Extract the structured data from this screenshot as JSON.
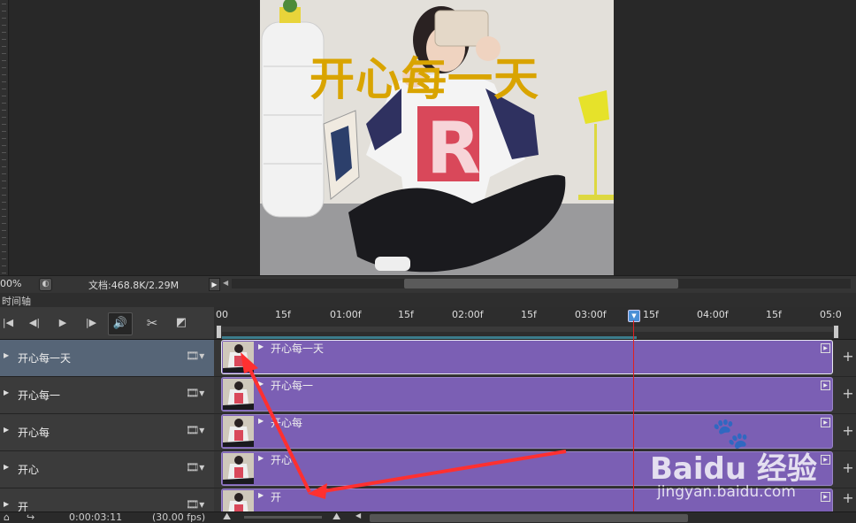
{
  "canvas": {
    "overlay_text": "开心每一天"
  },
  "statusbar": {
    "zoom": "00%",
    "doc_info": "文档:468.8K/2.29M"
  },
  "panel": {
    "tab_label": "时间轴"
  },
  "controls": {
    "first_frame": "|◀",
    "prev_frame": "◀|",
    "play": "▶",
    "next_frame": "|▶",
    "audio": "🔊",
    "split": "✂",
    "transition": "◩"
  },
  "time_ruler": {
    "labels": [
      "00",
      "15f",
      "01:00f",
      "15f",
      "02:00f",
      "15f",
      "03:00f",
      "15f",
      "04:00f",
      "15f",
      "05:0"
    ],
    "playhead_time": "0:00:03:11"
  },
  "layers": [
    {
      "name": "开心每一天",
      "clip_label": "开心每一天",
      "selected": true
    },
    {
      "name": "开心每一",
      "clip_label": "开心每一",
      "selected": false
    },
    {
      "name": "开心每",
      "clip_label": "开心每",
      "selected": false
    },
    {
      "name": "开心",
      "clip_label": "开心",
      "selected": false
    },
    {
      "name": "开",
      "clip_label": "开",
      "selected": false
    }
  ],
  "bottombar": {
    "timecode": "0:00:03:11",
    "fps": "(30.00 fps)"
  },
  "watermark": {
    "brand": "Baidu 经验",
    "url": "jingyan.baidu.com"
  },
  "colors": {
    "clip": "#7b5fb4",
    "playhead": "#e02020",
    "overlay_text": "#d9a400",
    "annotation_arrow": "#ff3030"
  }
}
